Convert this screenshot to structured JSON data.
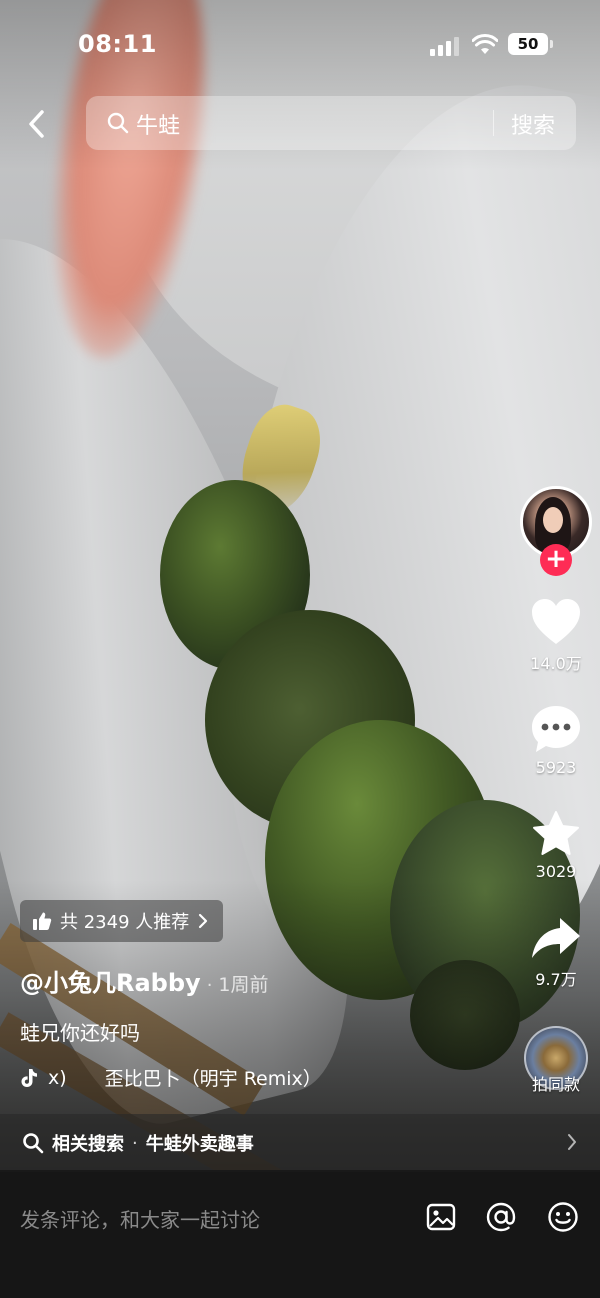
{
  "status_bar": {
    "time": "08:11",
    "battery": "50"
  },
  "search": {
    "query": "牛蛙",
    "button_label": "搜索"
  },
  "video": {
    "description": "bullfrogs in a white plastic bag"
  },
  "actions": {
    "likes": "14.0万",
    "comments": "5923",
    "favorites": "3029",
    "shares": "9.7万",
    "same_style_label": "拍同款"
  },
  "recommend": {
    "text": "共 2349 人推荐"
  },
  "post": {
    "author": "@小兔几Rabby",
    "separator": "·",
    "time_ago": "1周前",
    "caption": "蛙兄你还好吗",
    "music_prefix": "x)",
    "music_title": "歪比巴卜（明宇 Remix）"
  },
  "related_search": {
    "label": "相关搜索",
    "separator": "·",
    "term": "牛蛙外卖趣事"
  },
  "comment_bar": {
    "placeholder": "发条评论，和大家一起讨论"
  },
  "colors": {
    "accent": "#fe2c55",
    "bar_bg": "#161616"
  },
  "icons": [
    "back-icon",
    "search-icon",
    "heart-icon",
    "comment-icon",
    "star-icon",
    "share-icon",
    "tiktok-note-icon",
    "chevron-right-icon",
    "image-icon",
    "at-icon",
    "emoji-icon",
    "thumbs-up-icon"
  ]
}
